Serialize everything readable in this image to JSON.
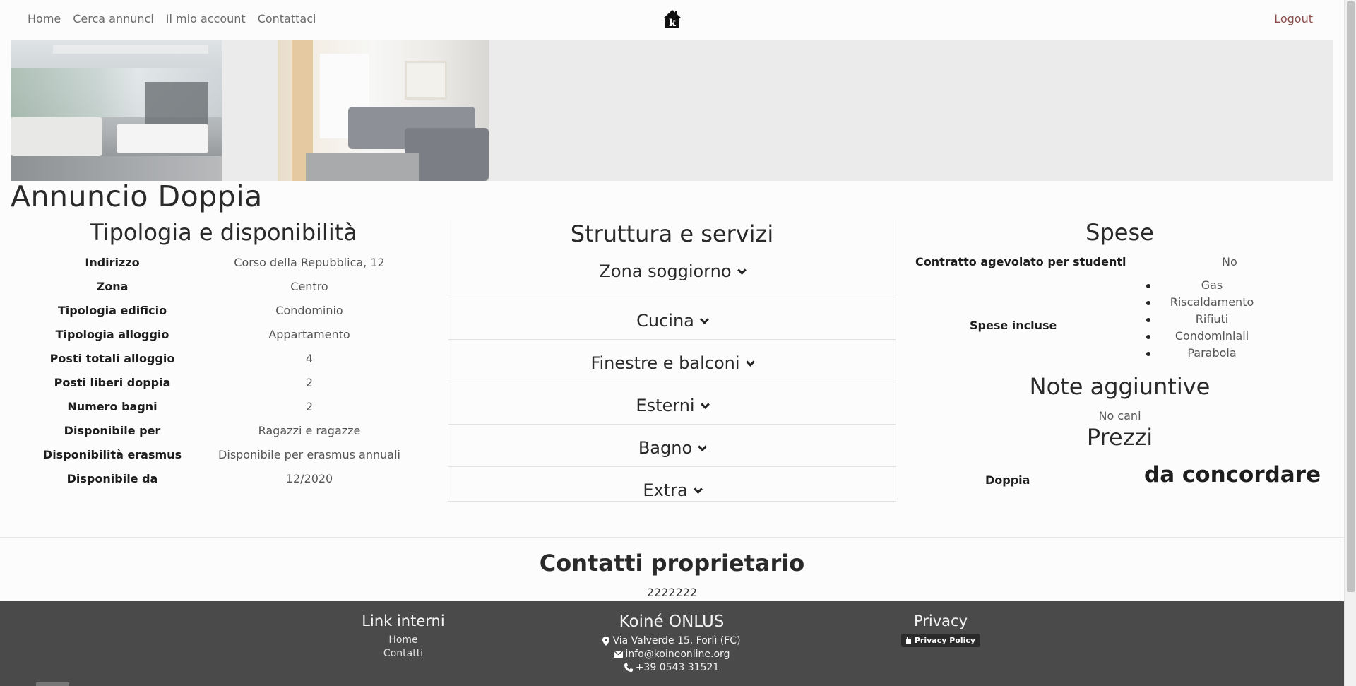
{
  "nav": {
    "links": [
      "Home",
      "Cerca annunci",
      "Il mio account",
      "Contattaci"
    ],
    "logout": "Logout",
    "logo_letter": "k"
  },
  "page": {
    "title": "Annuncio Doppia"
  },
  "tipologia": {
    "title": "Tipologia e disponibilità",
    "rows": [
      {
        "label": "Indirizzo",
        "value": "Corso della Repubblica, 12"
      },
      {
        "label": "Zona",
        "value": "Centro"
      },
      {
        "label": "Tipologia edificio",
        "value": "Condominio"
      },
      {
        "label": "Tipologia alloggio",
        "value": "Appartamento"
      },
      {
        "label": "Posti totali alloggio",
        "value": "4"
      },
      {
        "label": "Posti liberi doppia",
        "value": "2"
      },
      {
        "label": "Numero bagni",
        "value": "2"
      },
      {
        "label": "Disponibile per",
        "value": "Ragazzi e ragazze"
      },
      {
        "label": "Disponibilità erasmus",
        "value": "Disponibile per erasmus annuali"
      },
      {
        "label": "Disponibile da",
        "value": "12/2020"
      }
    ]
  },
  "struttura": {
    "title": "Struttura e servizi",
    "sections": [
      "Zona soggiorno",
      "Cucina",
      "Finestre e balconi",
      "Esterni",
      "Bagno",
      "Extra"
    ]
  },
  "spese": {
    "title": "Spese",
    "contratto_label": "Contratto agevolato per studenti",
    "contratto_value": "No",
    "incluse_label": "Spese incluse",
    "incluse": [
      "Gas",
      "Riscaldamento",
      "Rifiuti",
      "Condominiali",
      "Parabola"
    ]
  },
  "note": {
    "title": "Note aggiuntive",
    "text": "No cani"
  },
  "prezzi": {
    "title": "Prezzi",
    "label": "Doppia",
    "value": "da concordare"
  },
  "contatti": {
    "title": "Contatti proprietario",
    "phone": "2222222"
  },
  "footer": {
    "links_title": "Link interni",
    "links": [
      "Home",
      "Contatti"
    ],
    "org_title": "Koiné ONLUS",
    "address": "Via Valverde 15, Forlì (FC)",
    "email": "info@koineonline.org",
    "phone": "+39 0543 31521",
    "privacy_title": "Privacy",
    "privacy_badge": "Privacy Policy"
  },
  "colors": {
    "footer_bg": "#4a4a4a",
    "logout": "#8b4a48",
    "gallery_bg": "#ebebeb"
  }
}
